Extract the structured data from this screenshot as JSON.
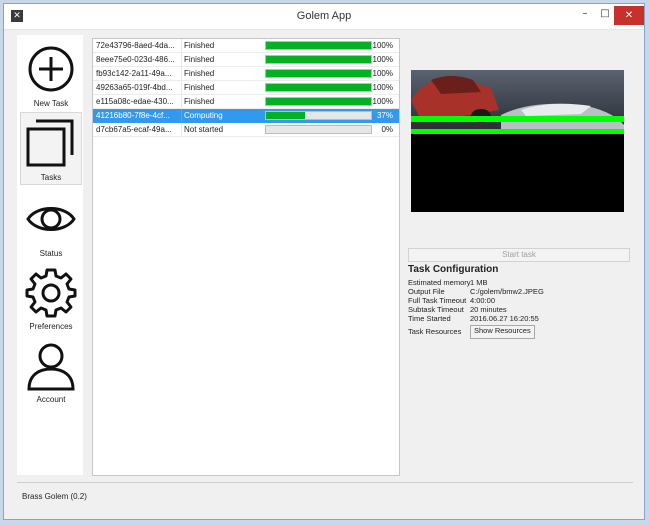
{
  "window": {
    "title": "Golem App",
    "app_icon": "golem-logo-icon",
    "controls": {
      "minimize": "–",
      "maximize": "□",
      "close": "✕"
    }
  },
  "sidebar": {
    "items": [
      {
        "label": "New Task",
        "icon": "plus-circle-icon",
        "active": false
      },
      {
        "label": "Tasks",
        "icon": "stacked-squares-icon",
        "active": true
      },
      {
        "label": "Status",
        "icon": "eye-icon",
        "active": false
      },
      {
        "label": "Preferences",
        "icon": "gear-icon",
        "active": false
      },
      {
        "label": "Account",
        "icon": "user-icon",
        "active": false
      }
    ]
  },
  "tasks": [
    {
      "id": "72e43796-8aed-4da...",
      "status": "Finished",
      "progress": 100,
      "progress_label": "100%"
    },
    {
      "id": "8eee75e0-023d-486...",
      "status": "Finished",
      "progress": 100,
      "progress_label": "100%"
    },
    {
      "id": "fb93c142-2a11-49a...",
      "status": "Finished",
      "progress": 100,
      "progress_label": "100%"
    },
    {
      "id": "49263a65-019f-4bd...",
      "status": "Finished",
      "progress": 100,
      "progress_label": "100%"
    },
    {
      "id": "e115a08c-edae-430...",
      "status": "Finished",
      "progress": 100,
      "progress_label": "100%"
    },
    {
      "id": "41216b80-7f8e-4cf...",
      "status": "Computing",
      "progress": 37,
      "progress_label": "37%",
      "selected": true
    },
    {
      "id": "d7cb67a5-ecaf-49a...",
      "status": "Not started",
      "progress": 0,
      "progress_label": "0%"
    }
  ],
  "preview": {
    "description_icon": "render-preview-image",
    "progress_line_color": "#00ff00"
  },
  "start_button": {
    "label": "Start task",
    "enabled": false
  },
  "config": {
    "title": "Task Configuration",
    "rows": [
      {
        "label": "Estimated memory",
        "value": "1 MB"
      },
      {
        "label": "Output File",
        "value": "C:/golem/bmw2.JPEG"
      },
      {
        "label": "Full Task Timeout",
        "value": "4:00:00"
      },
      {
        "label": "Subtask Timeout",
        "value": "20 minutes"
      },
      {
        "label": "Time Started",
        "value": "2016.06.27  16:20:55"
      }
    ],
    "resources_label": "Task Resources",
    "resources_button": "Show Resources"
  },
  "statusbar": {
    "text": "Brass Golem (0.2)"
  },
  "colors": {
    "progress": "#06b025",
    "selected_row": "#3399ee",
    "close_button": "#c7312c"
  }
}
